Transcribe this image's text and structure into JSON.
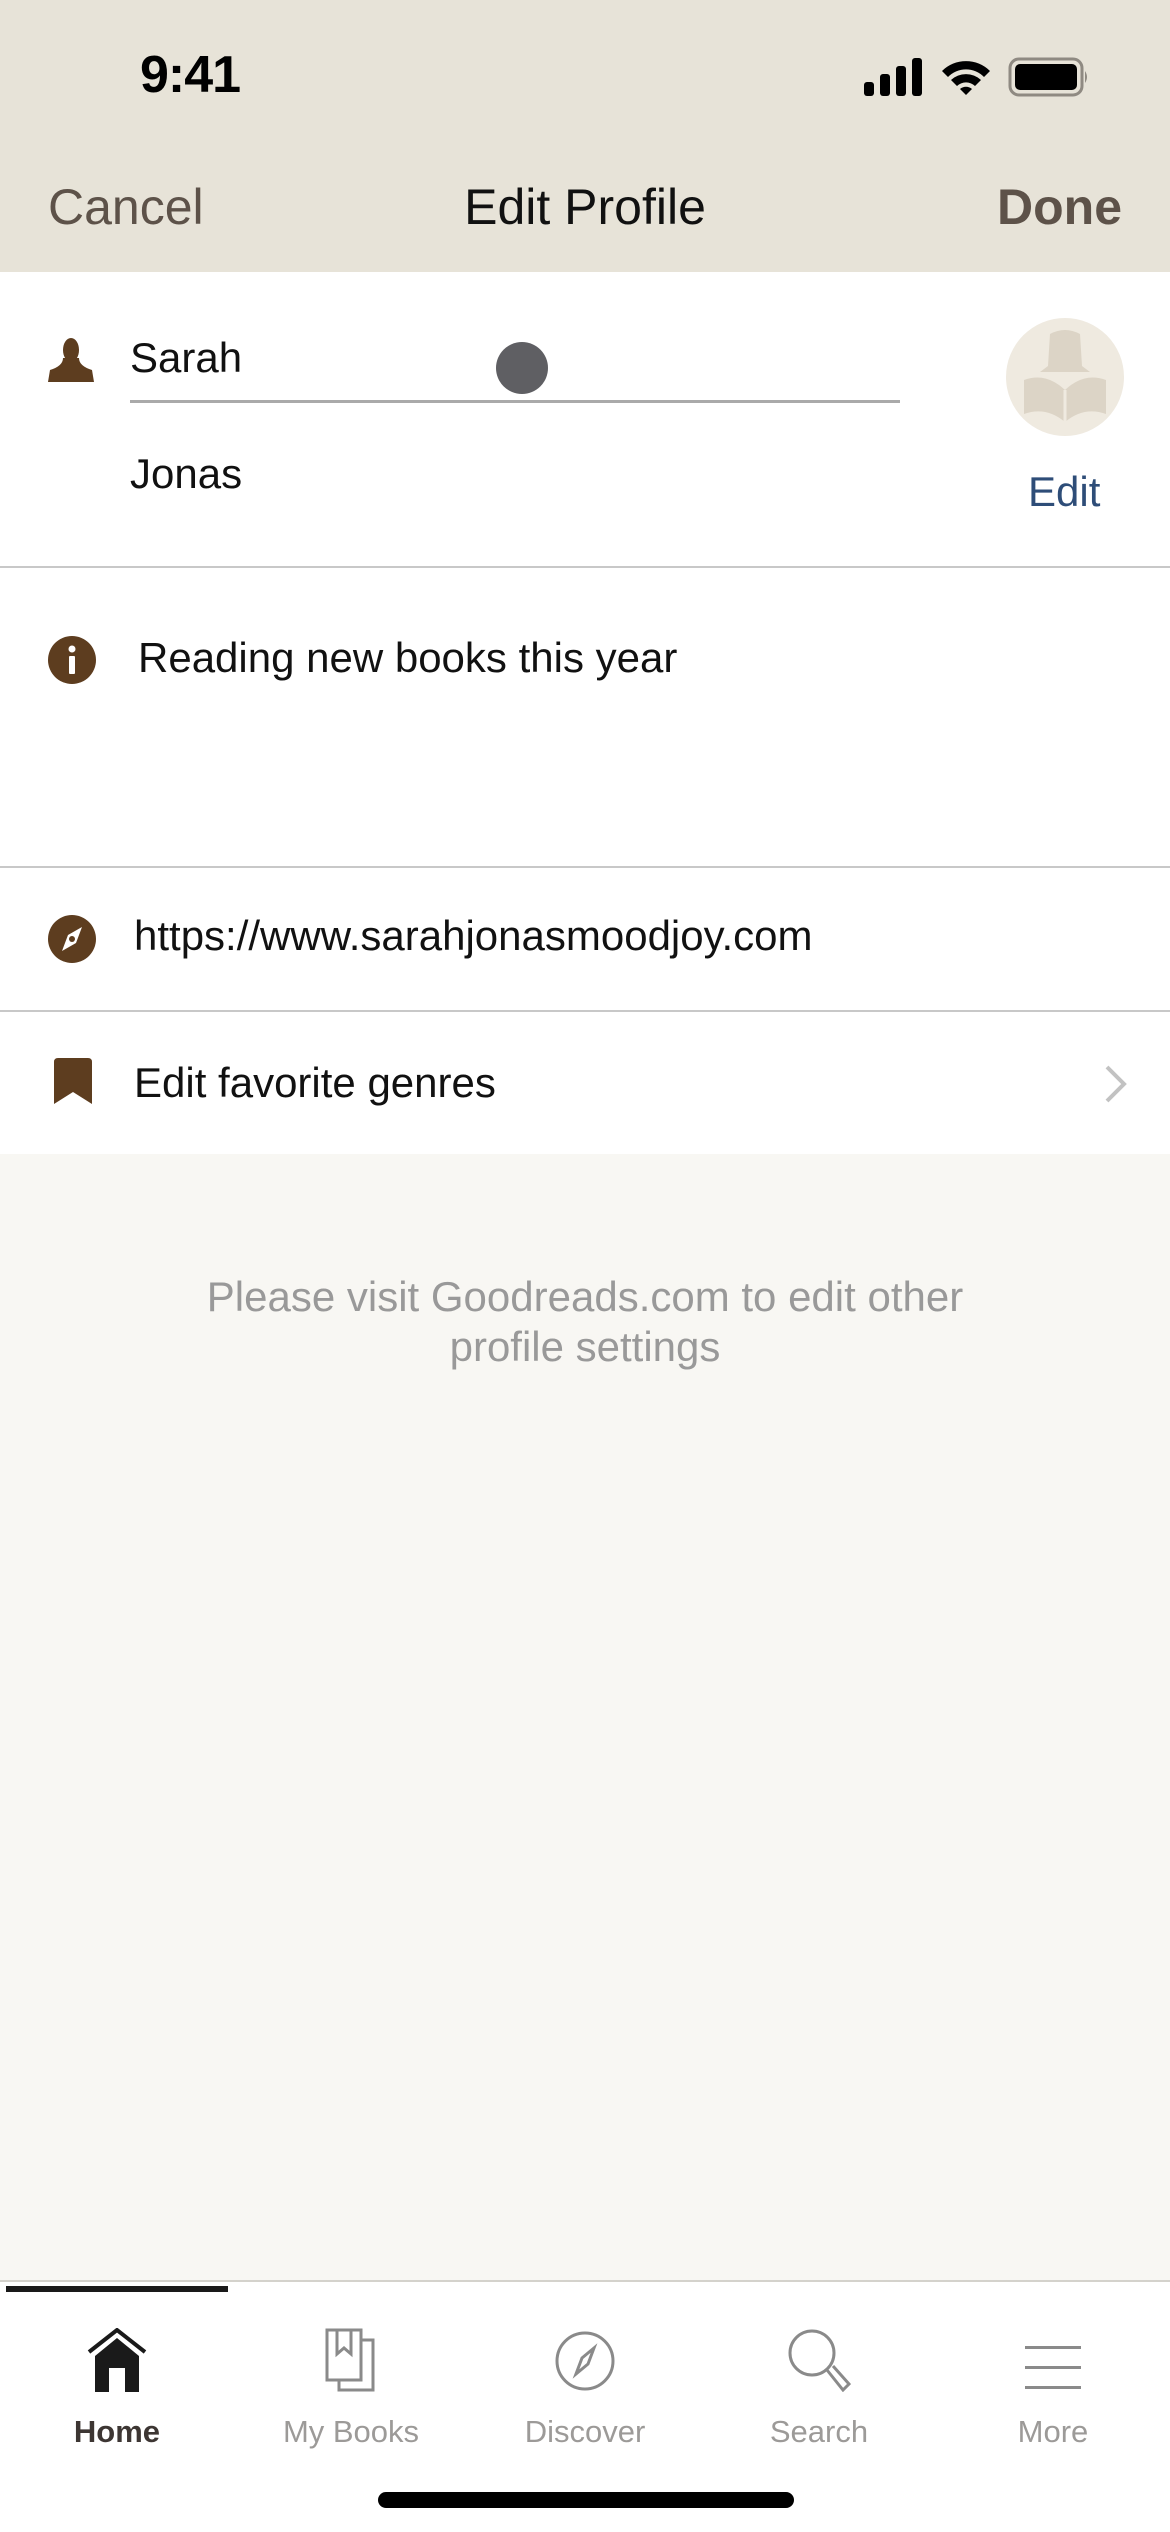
{
  "status_bar": {
    "time": "9:41",
    "icons": [
      "cellular-signal-icon",
      "wifi-icon",
      "battery-icon"
    ]
  },
  "nav": {
    "cancel_label": "Cancel",
    "title": "Edit Profile",
    "done_label": "Done"
  },
  "profile": {
    "first_name": "Sarah",
    "last_name": "Jonas",
    "avatar_edit_label": "Edit",
    "about": "Reading new books this year",
    "website": "https://www.sarahjonasmoodjoy.com",
    "genres_label": "Edit favorite genres"
  },
  "footer_note": {
    "line1": "Please visit Goodreads.com to edit other",
    "line2": "profile settings"
  },
  "tabbar": {
    "active": "Home",
    "tabs": [
      {
        "label": "Home",
        "icon": "home-icon"
      },
      {
        "label": "My Books",
        "icon": "my-books-icon"
      },
      {
        "label": "Discover",
        "icon": "compass-icon"
      },
      {
        "label": "Search",
        "icon": "search-icon"
      },
      {
        "label": "More",
        "icon": "menu-icon"
      }
    ]
  },
  "colors": {
    "header_bg": "#e7e3d8",
    "accent_brown": "#5d3d1f",
    "link_blue": "#2e4d78",
    "page_bg": "#f8f7f3"
  }
}
